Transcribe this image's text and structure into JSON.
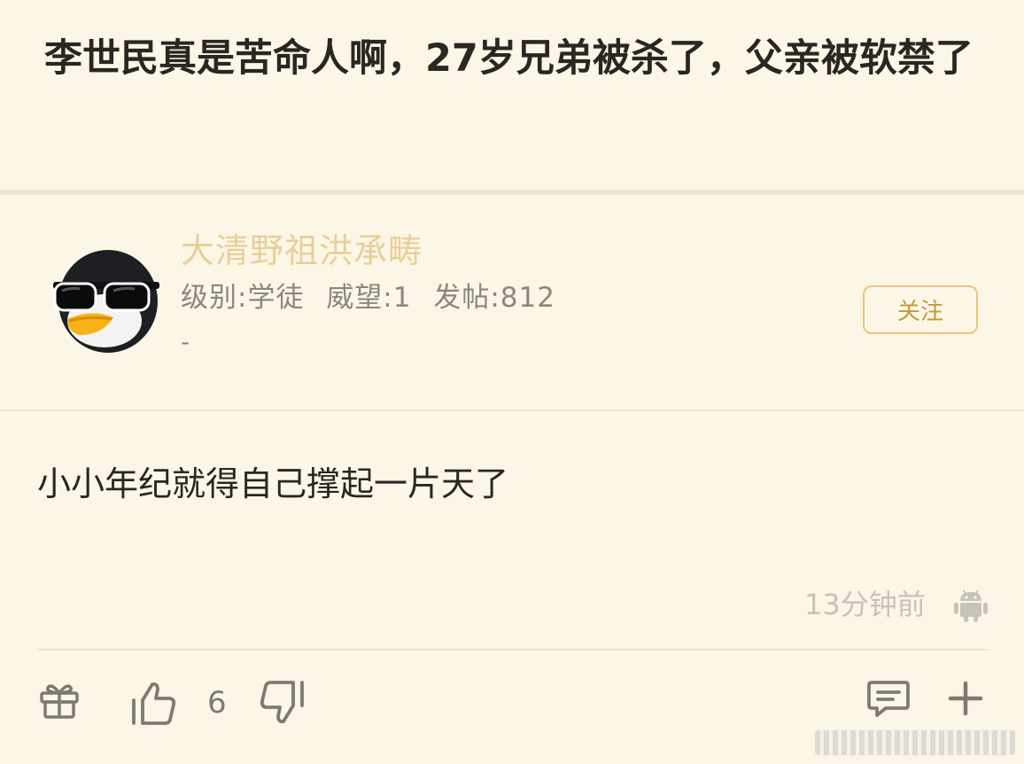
{
  "post": {
    "title": "李世民真是苦命人啊，27岁兄弟被杀了，父亲被软禁了"
  },
  "user": {
    "name": "大清野祖洪承畴",
    "level": "级别:学徒",
    "reputation": "威望:1",
    "posts": "发帖:812",
    "extra": "-",
    "follow_label": "关注",
    "avatar_icon": "penguin-sunglasses-avatar"
  },
  "comment": {
    "text": "小小年纪就得自己撑起一片天了",
    "time": "13分钟前",
    "platform_icon": "android-icon"
  },
  "actions": {
    "like_count": "6",
    "icons": [
      "gift-icon",
      "thumbs-up-icon",
      "thumbs-down-icon",
      "reply-icon",
      "plus-icon"
    ]
  },
  "colors": {
    "background": "#fcf6e6",
    "username": "#e8cf98",
    "follow_border": "#e8c879",
    "follow_text": "#c39a3e",
    "meta_text": "#8b877f",
    "timestamp": "#c8c3b8"
  }
}
